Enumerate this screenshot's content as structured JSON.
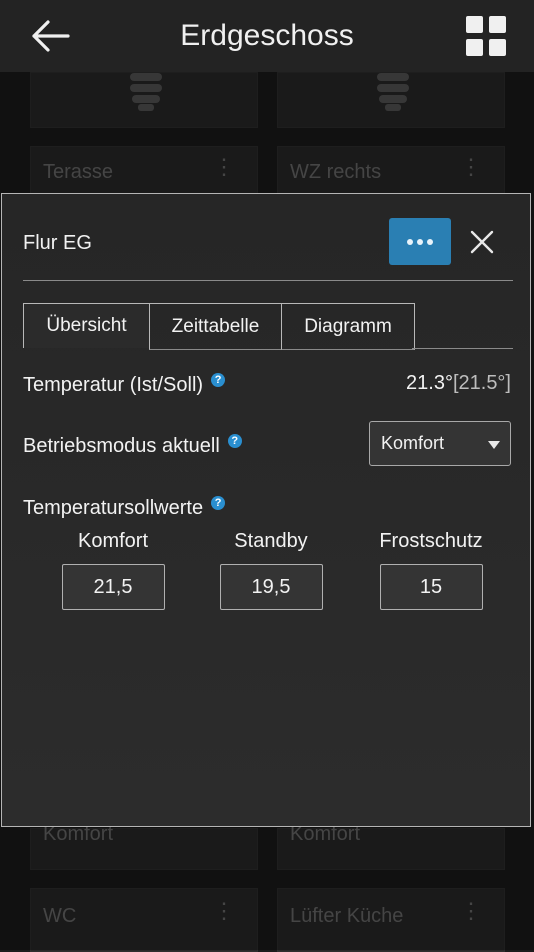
{
  "appbar": {
    "title": "Erdgeschoss",
    "back_icon": "arrow-left-icon",
    "grid_icon": "grid-icon"
  },
  "background_tiles": [
    {
      "label": "Terasse"
    },
    {
      "label": "WZ rechts"
    },
    {
      "label": "Komfort"
    },
    {
      "label": "Komfort"
    },
    {
      "label": "WC"
    },
    {
      "label": "Lüfter Küche"
    }
  ],
  "dialog": {
    "title": "Flur EG",
    "menu_icon": "ellipsis-icon",
    "close_icon": "close-icon",
    "tabs": [
      {
        "label": "Übersicht",
        "active": true
      },
      {
        "label": "Zeittabelle",
        "active": false
      },
      {
        "label": "Diagramm",
        "active": false
      }
    ],
    "temperature": {
      "label": "Temperatur (Ist/Soll)",
      "ist": "21.3°",
      "soll": "[21.5°]"
    },
    "mode": {
      "label": "Betriebsmodus aktuell",
      "selected": "Komfort"
    },
    "setpoints": {
      "label": "Temperatursollwerte",
      "items": [
        {
          "name": "Komfort",
          "value": "21,5"
        },
        {
          "name": "Standby",
          "value": "19,5"
        },
        {
          "name": "Frostschutz",
          "value": "15"
        }
      ]
    },
    "help_glyph": "?"
  },
  "colors": {
    "accent": "#2a7fb3",
    "help": "#2a8fd0",
    "background": "#1b1b1b"
  }
}
